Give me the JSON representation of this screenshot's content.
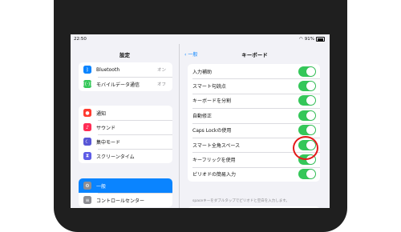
{
  "status": {
    "time": "22:50",
    "battery": "91%"
  },
  "sidebar": {
    "title": "設定",
    "groups": [
      [
        {
          "label": "Bluetooth",
          "value": "オン",
          "icon": "bluetooth-icon",
          "color": "#0a84ff",
          "glyph": "ᛒ"
        },
        {
          "label": "モバイルデータ通信",
          "value": "オフ",
          "icon": "antenna-icon",
          "color": "#34c759",
          "glyph": "((·))"
        }
      ],
      [
        {
          "label": "通知",
          "icon": "bell-icon",
          "color": "#ff3b30",
          "glyph": "●"
        },
        {
          "label": "サウンド",
          "icon": "speaker-icon",
          "color": "#ff2d55",
          "glyph": "♪"
        },
        {
          "label": "集中モード",
          "icon": "moon-icon",
          "color": "#5856d6",
          "glyph": "☾"
        },
        {
          "label": "スクリーンタイム",
          "icon": "hourglass-icon",
          "color": "#5e5ce6",
          "glyph": "⧗"
        }
      ],
      [
        {
          "label": "一般",
          "icon": "gear-icon",
          "color": "#8e8e93",
          "glyph": "⚙",
          "selected": true
        },
        {
          "label": "コントロールセンター",
          "icon": "switches-icon",
          "color": "#8e8e93",
          "glyph": "≡"
        }
      ]
    ]
  },
  "main": {
    "back_label": "一般",
    "title": "キーボード",
    "rows": [
      {
        "label": "入力補助",
        "on": true
      },
      {
        "label": "スマート句読点",
        "on": true
      },
      {
        "label": "キーボードを分割",
        "on": true
      },
      {
        "label": "自動修正",
        "on": true
      },
      {
        "label": "Caps Lockの使用",
        "on": true
      },
      {
        "label": "スマート全角スペース",
        "on": true
      },
      {
        "label": "キーフリックを使用",
        "on": true
      },
      {
        "label": "ピリオドの簡易入力",
        "on": true
      }
    ],
    "footnote": "spaceキーをダブルタップでピリオドと空白を入力します。"
  },
  "colors": {
    "accent": "#0a84ff",
    "toggle_on": "#34c759",
    "highlight": "#e41a1a"
  }
}
